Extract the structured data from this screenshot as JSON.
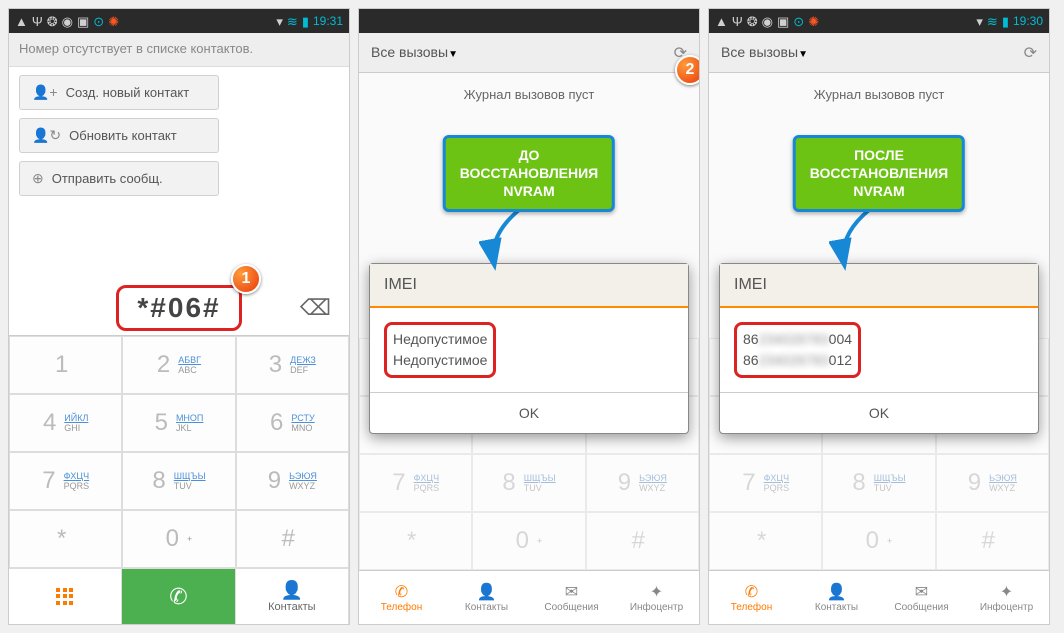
{
  "status": {
    "time1": "19:31",
    "time2": "19:30",
    "icons_left": [
      "▲",
      "Ψ",
      "✿",
      "◉",
      "▣",
      "⊙",
      "❄"
    ],
    "icons_right": [
      "▾",
      "≋",
      "▮"
    ]
  },
  "screen1": {
    "sub_header": "Номер отсутствует в списке контактов.",
    "chip1": "Созд. новый контакт",
    "chip2": "Обновить контакт",
    "chip3": "Отправить сообщ.",
    "dial_code": "*#06#",
    "keys": [
      {
        "d": "1",
        "c": "",
        "l": ""
      },
      {
        "d": "2",
        "c": "АБВГ",
        "l": "ABC"
      },
      {
        "d": "3",
        "c": "ДЕЖЗ",
        "l": "DEF"
      },
      {
        "d": "4",
        "c": "ИЙКЛ",
        "l": "GHI"
      },
      {
        "d": "5",
        "c": "МНОП",
        "l": "JKL"
      },
      {
        "d": "6",
        "c": "РСТУ",
        "l": "MNO"
      },
      {
        "d": "7",
        "c": "ФХЦЧ",
        "l": "PQRS"
      },
      {
        "d": "8",
        "c": "ШЩЪЫ",
        "l": "TUV"
      },
      {
        "d": "9",
        "c": "ЬЭЮЯ",
        "l": "WXYZ"
      },
      {
        "d": "*",
        "c": "",
        "l": ""
      },
      {
        "d": "0",
        "c": "",
        "l": "+"
      },
      {
        "d": "#",
        "c": "",
        "l": ""
      }
    ],
    "bottom": {
      "contacts": "Контакты"
    },
    "marker": "1"
  },
  "screen2": {
    "header": "Все вызовы",
    "empty": "Журнал вызовов пуст",
    "callout": "ДО\nВОССТАНОВЛЕНИЯ\nNVRAM",
    "imei_title": "IMEI",
    "imei_line1": "Недопустимое",
    "imei_line2": "Недопустимое",
    "ok": "OK",
    "tabs": [
      "Телефон",
      "Контакты",
      "Сообщения",
      "Инфоцентр"
    ],
    "marker": "2"
  },
  "screen3": {
    "header": "Все вызовы",
    "empty": "Журнал вызовов пуст",
    "callout": "ПОСЛЕ\nВОССТАНОВЛЕНИЯ\nNVRAM",
    "imei_title": "IMEI",
    "imei_line1_prefix": "86",
    "imei_line1_suffix": "004",
    "imei_line2_prefix": "86",
    "imei_line2_suffix": "012",
    "ok": "OK",
    "tabs": [
      "Телефон",
      "Контакты",
      "Сообщения",
      "Инфоцентр"
    ]
  }
}
